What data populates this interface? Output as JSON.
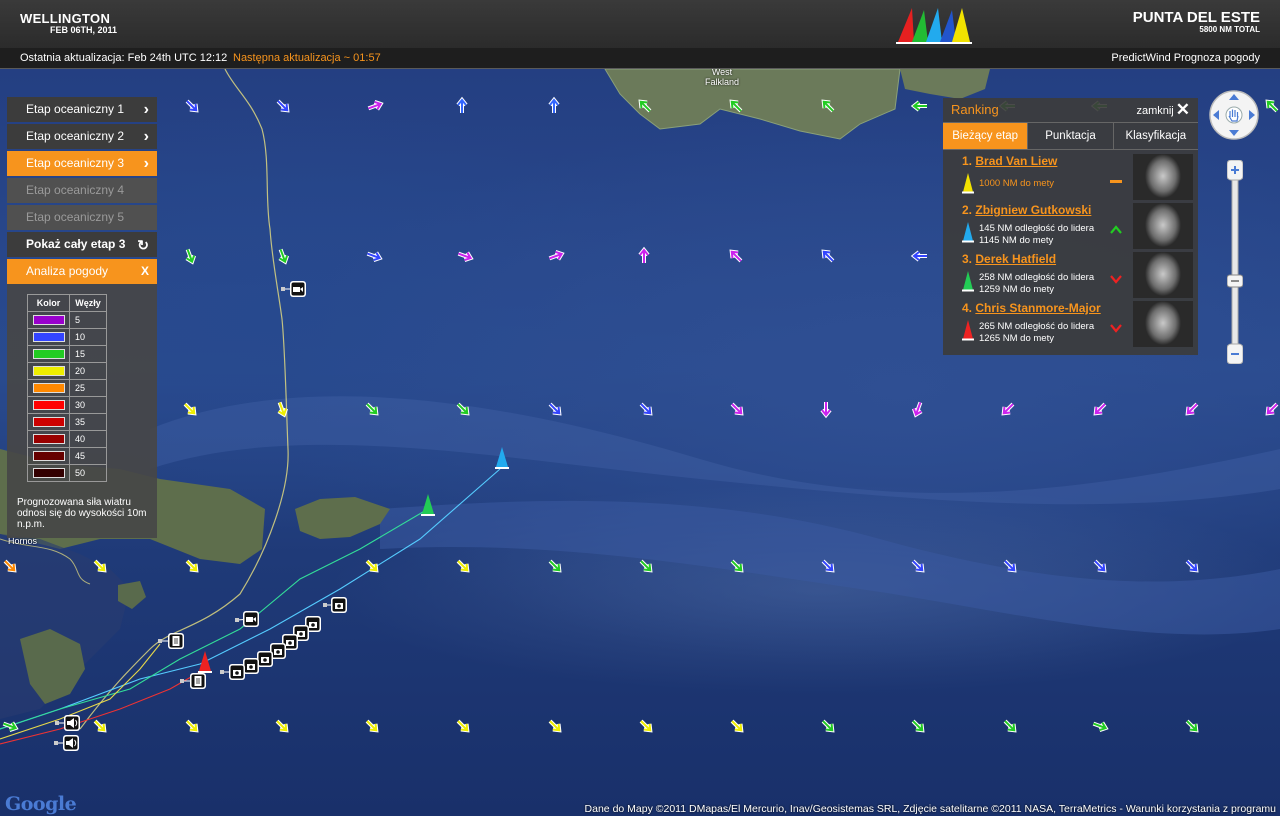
{
  "header": {
    "start_city": "WELLINGTON",
    "start_date": "FEB 06TH, 2011",
    "end_city": "PUNTA DEL ESTE",
    "end_total": "5800 NM TOTAL"
  },
  "status": {
    "last_update": "Ostatnia aktualizacja: Feb 24th UTC 12:12",
    "next_update": "Następna aktualizacja ~ 01:57",
    "provider": "PredictWind Prognoza pogody"
  },
  "stages": [
    {
      "label": "Etap oceaniczny 1",
      "state": "normal"
    },
    {
      "label": "Etap oceaniczny 2",
      "state": "normal"
    },
    {
      "label": "Etap oceaniczny 3",
      "state": "active"
    },
    {
      "label": "Etap oceaniczny 4",
      "state": "disabled"
    },
    {
      "label": "Etap oceaniczny 5",
      "state": "disabled"
    }
  ],
  "show_stage": "Pokaż cały etap 3",
  "weather": {
    "label": "Analiza pogody",
    "close": "X",
    "col_color": "Kolor",
    "col_knots": "Węzły",
    "rows": [
      {
        "color": "#9900cc",
        "knots": "5"
      },
      {
        "color": "#3344ff",
        "knots": "10"
      },
      {
        "color": "#22cc22",
        "knots": "15"
      },
      {
        "color": "#eeee00",
        "knots": "20"
      },
      {
        "color": "#ff8800",
        "knots": "25"
      },
      {
        "color": "#ff0000",
        "knots": "30"
      },
      {
        "color": "#cc0000",
        "knots": "35"
      },
      {
        "color": "#990000",
        "knots": "40"
      },
      {
        "color": "#660000",
        "knots": "45"
      },
      {
        "color": "#330000",
        "knots": "50"
      }
    ],
    "note": "Prognozowana siła wiatru odnosi się do wysokości 10m n.p.m."
  },
  "ranking": {
    "title": "Ranking",
    "close": "zamknij",
    "tabs": [
      "Bieżący etap",
      "Punktacja",
      "Klasyfikacja"
    ],
    "entries": [
      {
        "pos": "1.",
        "name": "Brad Van Liew",
        "line1": "1000 NM do mety",
        "line2": "",
        "boat": "#f2e200",
        "trend": "same"
      },
      {
        "pos": "2.",
        "name": "Zbigniew Gutkowski",
        "line1": "145 NM odległość do lidera",
        "line2": "1145 NM do mety",
        "boat": "#22aaee",
        "trend": "up"
      },
      {
        "pos": "3.",
        "name": "Derek Hatfield",
        "line1": "258 NM odległość do lidera",
        "line2": "1259 NM do mety",
        "boat": "#22cc55",
        "trend": "down"
      },
      {
        "pos": "4.",
        "name": "Chris Stanmore-Major",
        "line1": "265 NM odległość do lidera",
        "line2": "1265 NM do mety",
        "boat": "#ee2222",
        "trend": "down"
      }
    ]
  },
  "map_labels": {
    "west_falkland": "West Falkland",
    "hornos": "Hornos"
  },
  "footer": {
    "credit": "Dane do Mapy ©2011 DMapas/El Mercurio, Inav/Geosistemas SRL, Zdjęcie satelitarne ©2011 NASA, TerraMetrics - Warunki korzystania z programu",
    "google": "Google"
  }
}
